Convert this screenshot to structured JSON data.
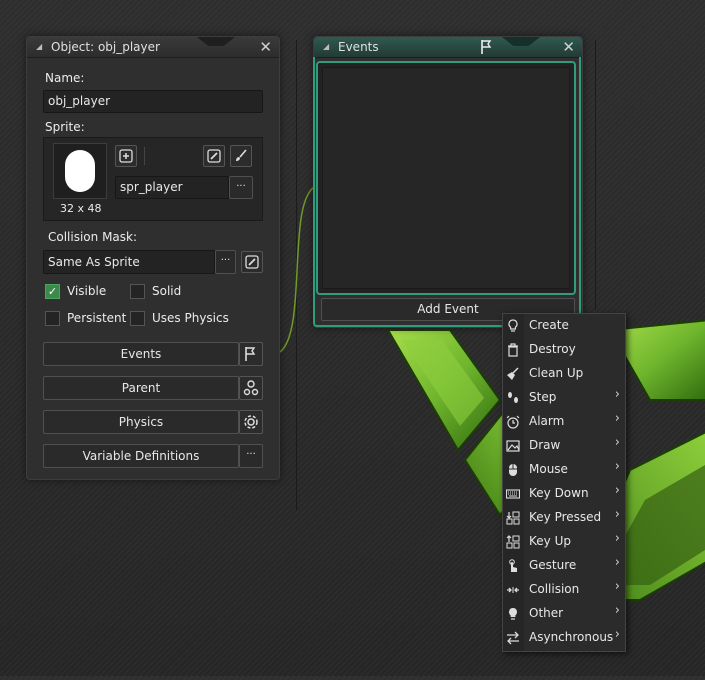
{
  "colors": {
    "accent": "#2f9c7e",
    "checkbox_on": "#3b8a4c",
    "logo_green": "#6fb52d"
  },
  "object_panel": {
    "title": "Object: obj_player",
    "name_label": "Name:",
    "name_value": "obj_player",
    "sprite_label": "Sprite:",
    "sprite_value": "spr_player",
    "sprite_size": "32 x 48",
    "collision_label": "Collision Mask:",
    "collision_value": "Same As Sprite",
    "checkboxes": [
      {
        "label": "Visible",
        "checked": true
      },
      {
        "label": "Solid",
        "checked": false
      },
      {
        "label": "Persistent",
        "checked": false
      },
      {
        "label": "Uses Physics",
        "checked": false
      }
    ],
    "buttons": {
      "events": "Events",
      "parent": "Parent",
      "physics": "Physics",
      "variable_definitions": "Variable Definitions"
    },
    "ellipsis": "···"
  },
  "events_panel": {
    "title": "Events",
    "add_event": "Add Event"
  },
  "event_menu": {
    "items": [
      {
        "label": "Create",
        "icon": "bulb-outline-icon",
        "submenu": false
      },
      {
        "label": "Destroy",
        "icon": "trash-icon",
        "submenu": false
      },
      {
        "label": "Clean Up",
        "icon": "broom-icon",
        "submenu": false
      },
      {
        "label": "Step",
        "icon": "footsteps-icon",
        "submenu": true
      },
      {
        "label": "Alarm",
        "icon": "alarm-clock-icon",
        "submenu": true
      },
      {
        "label": "Draw",
        "icon": "picture-icon",
        "submenu": true
      },
      {
        "label": "Mouse",
        "icon": "mouse-icon",
        "submenu": true
      },
      {
        "label": "Key Down",
        "icon": "keyboard-icon",
        "submenu": true
      },
      {
        "label": "Key Pressed",
        "icon": "key-pressed-icon",
        "submenu": true
      },
      {
        "label": "Key Up",
        "icon": "key-up-icon",
        "submenu": true
      },
      {
        "label": "Gesture",
        "icon": "hand-gesture-icon",
        "submenu": true
      },
      {
        "label": "Collision",
        "icon": "collision-arrows-icon",
        "submenu": true
      },
      {
        "label": "Other",
        "icon": "bulb-filled-icon",
        "submenu": true
      },
      {
        "label": "Asynchronous",
        "icon": "swap-arrows-icon",
        "submenu": true
      }
    ]
  }
}
